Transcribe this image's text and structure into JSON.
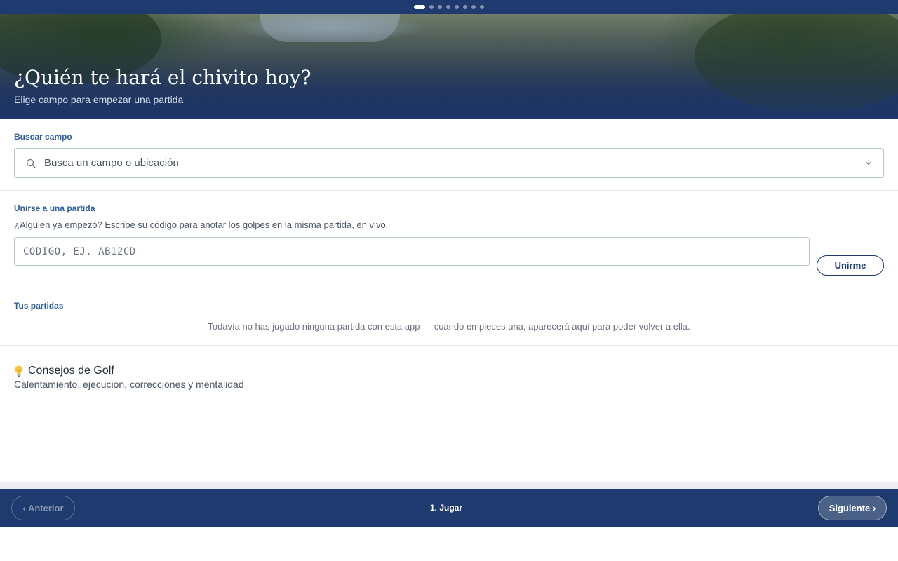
{
  "progress": {
    "total_steps": 8,
    "current_step": 1
  },
  "hero": {
    "title": "¿Quién te hará el chivito hoy?",
    "subtitle": "Elige campo para empezar una partida"
  },
  "search": {
    "label": "Buscar campo",
    "placeholder": "Busca un campo o ubicación",
    "value": ""
  },
  "join": {
    "label": "Unirse a una partida",
    "description": "¿Alguien ya empezó? Escribe su código para anotar los golpes en la misma partida, en vivo.",
    "placeholder": "CÓDIGO, EJ. AB12CD",
    "button_label": "Unirme"
  },
  "games": {
    "label": "Tus partidas",
    "empty_text": "Todavía no has jugado ninguna partida con esta app — cuando empieces una, aparecerá aquí para poder volver a ella."
  },
  "tips": {
    "icon": "lightbulb-icon",
    "title": "Consejos de Golf",
    "subtitle": "Calentamiento, ejecución, correcciones y mentalidad"
  },
  "footer": {
    "prev_label": "‹ Anterior",
    "step_label": "1. Jugar",
    "next_label": "Siguiente ›"
  },
  "colors": {
    "primary": "#1e3a6e",
    "section_label": "#2f5f98",
    "input_border": "#b7c9c9"
  }
}
